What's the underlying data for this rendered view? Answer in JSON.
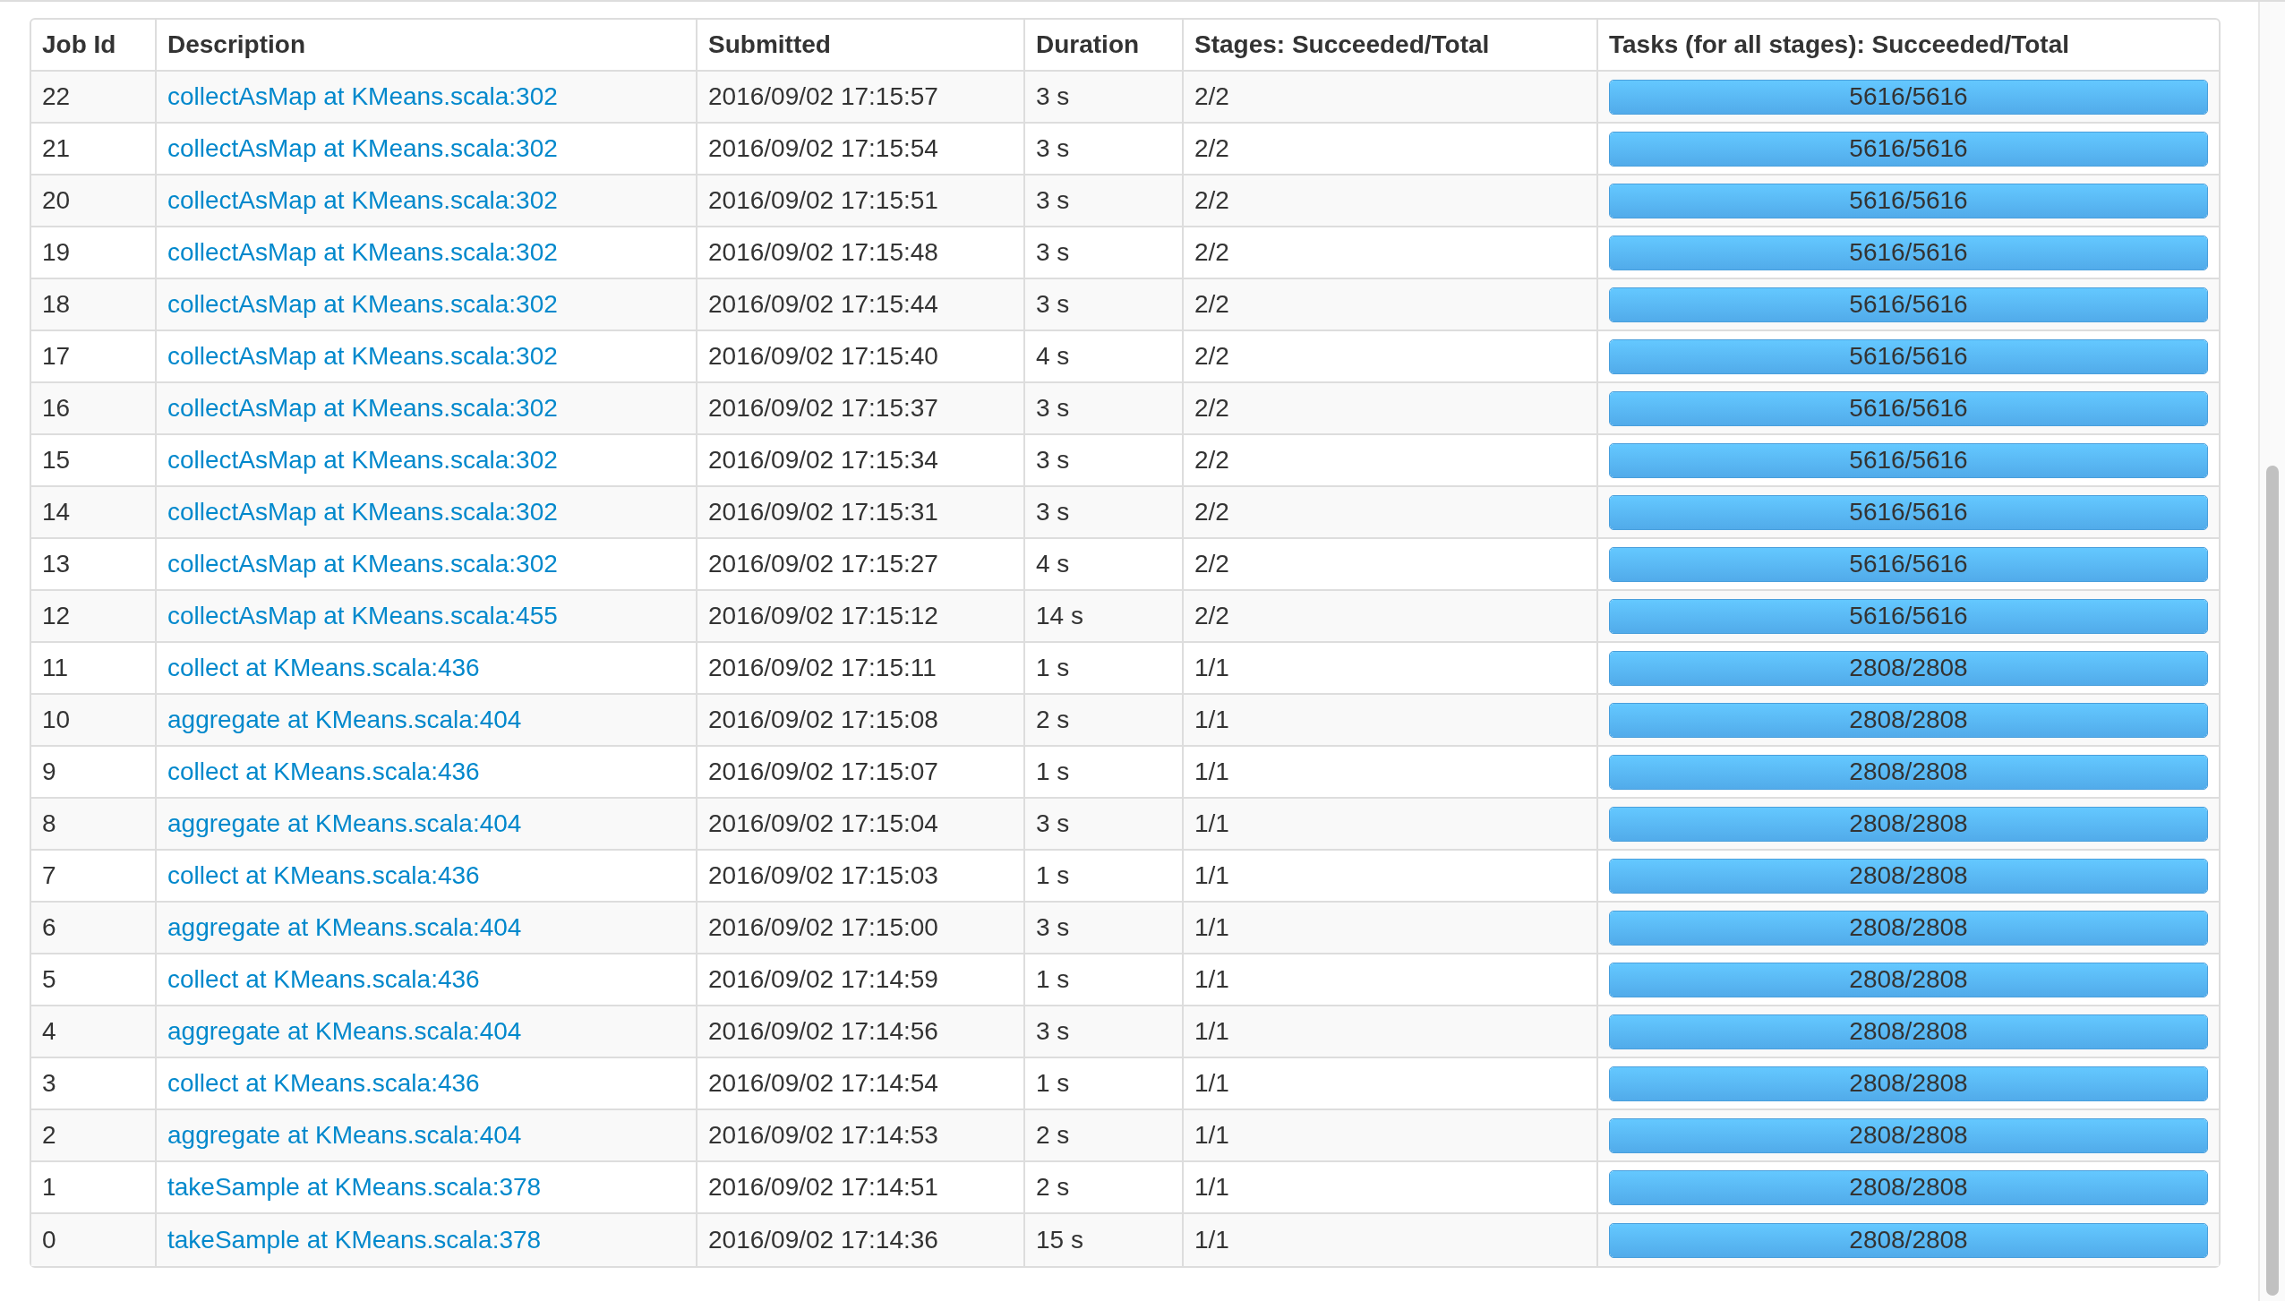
{
  "table": {
    "columns": [
      "Job Id",
      "Description",
      "Submitted",
      "Duration",
      "Stages: Succeeded/Total",
      "Tasks (for all stages): Succeeded/Total"
    ],
    "rows": [
      {
        "job_id": "22",
        "description": "collectAsMap at KMeans.scala:302",
        "submitted": "2016/09/02 17:15:57",
        "duration": "3 s",
        "stages": "2/2",
        "tasks": "5616/5616",
        "level": 1
      },
      {
        "job_id": "21",
        "description": "collectAsMap at KMeans.scala:302",
        "submitted": "2016/09/02 17:15:54",
        "duration": "3 s",
        "stages": "2/2",
        "tasks": "5616/5616",
        "level": 1
      },
      {
        "job_id": "20",
        "description": "collectAsMap at KMeans.scala:302",
        "submitted": "2016/09/02 17:15:51",
        "duration": "3 s",
        "stages": "2/2",
        "tasks": "5616/5616",
        "level": 1
      },
      {
        "job_id": "19",
        "description": "collectAsMap at KMeans.scala:302",
        "submitted": "2016/09/02 17:15:48",
        "duration": "3 s",
        "stages": "2/2",
        "tasks": "5616/5616",
        "level": 1
      },
      {
        "job_id": "18",
        "description": "collectAsMap at KMeans.scala:302",
        "submitted": "2016/09/02 17:15:44",
        "duration": "3 s",
        "stages": "2/2",
        "tasks": "5616/5616",
        "level": 1
      },
      {
        "job_id": "17",
        "description": "collectAsMap at KMeans.scala:302",
        "submitted": "2016/09/02 17:15:40",
        "duration": "4 s",
        "stages": "2/2",
        "tasks": "5616/5616",
        "level": 1
      },
      {
        "job_id": "16",
        "description": "collectAsMap at KMeans.scala:302",
        "submitted": "2016/09/02 17:15:37",
        "duration": "3 s",
        "stages": "2/2",
        "tasks": "5616/5616",
        "level": 1
      },
      {
        "job_id": "15",
        "description": "collectAsMap at KMeans.scala:302",
        "submitted": "2016/09/02 17:15:34",
        "duration": "3 s",
        "stages": "2/2",
        "tasks": "5616/5616",
        "level": 1
      },
      {
        "job_id": "14",
        "description": "collectAsMap at KMeans.scala:302",
        "submitted": "2016/09/02 17:15:31",
        "duration": "3 s",
        "stages": "2/2",
        "tasks": "5616/5616",
        "level": 1
      },
      {
        "job_id": "13",
        "description": "collectAsMap at KMeans.scala:302",
        "submitted": "2016/09/02 17:15:27",
        "duration": "4 s",
        "stages": "2/2",
        "tasks": "5616/5616",
        "level": 1
      },
      {
        "job_id": "12",
        "description": "collectAsMap at KMeans.scala:455",
        "submitted": "2016/09/02 17:15:12",
        "duration": "14 s",
        "stages": "2/2",
        "tasks": "5616/5616",
        "level": 1
      },
      {
        "job_id": "11",
        "description": "collect at KMeans.scala:436",
        "submitted": "2016/09/02 17:15:11",
        "duration": "1 s",
        "stages": "1/1",
        "tasks": "2808/2808",
        "level": 1
      },
      {
        "job_id": "10",
        "description": "aggregate at KMeans.scala:404",
        "submitted": "2016/09/02 17:15:08",
        "duration": "2 s",
        "stages": "1/1",
        "tasks": "2808/2808",
        "level": 1
      },
      {
        "job_id": "9",
        "description": "collect at KMeans.scala:436",
        "submitted": "2016/09/02 17:15:07",
        "duration": "1 s",
        "stages": "1/1",
        "tasks": "2808/2808",
        "level": 1
      },
      {
        "job_id": "8",
        "description": "aggregate at KMeans.scala:404",
        "submitted": "2016/09/02 17:15:04",
        "duration": "3 s",
        "stages": "1/1",
        "tasks": "2808/2808",
        "level": 1
      },
      {
        "job_id": "7",
        "description": "collect at KMeans.scala:436",
        "submitted": "2016/09/02 17:15:03",
        "duration": "1 s",
        "stages": "1/1",
        "tasks": "2808/2808",
        "level": 1
      },
      {
        "job_id": "6",
        "description": "aggregate at KMeans.scala:404",
        "submitted": "2016/09/02 17:15:00",
        "duration": "3 s",
        "stages": "1/1",
        "tasks": "2808/2808",
        "level": 1
      },
      {
        "job_id": "5",
        "description": "collect at KMeans.scala:436",
        "submitted": "2016/09/02 17:14:59",
        "duration": "1 s",
        "stages": "1/1",
        "tasks": "2808/2808",
        "level": 1
      },
      {
        "job_id": "4",
        "description": "aggregate at KMeans.scala:404",
        "submitted": "2016/09/02 17:14:56",
        "duration": "3 s",
        "stages": "1/1",
        "tasks": "2808/2808",
        "level": 1
      },
      {
        "job_id": "3",
        "description": "collect at KMeans.scala:436",
        "submitted": "2016/09/02 17:14:54",
        "duration": "1 s",
        "stages": "1/1",
        "tasks": "2808/2808",
        "level": 1
      },
      {
        "job_id": "2",
        "description": "aggregate at KMeans.scala:404",
        "submitted": "2016/09/02 17:14:53",
        "duration": "2 s",
        "stages": "1/1",
        "tasks": "2808/2808",
        "level": 1
      },
      {
        "job_id": "1",
        "description": "takeSample at KMeans.scala:378",
        "submitted": "2016/09/02 17:14:51",
        "duration": "2 s",
        "stages": "1/1",
        "tasks": "2808/2808",
        "level": 1
      },
      {
        "job_id": "0",
        "description": "takeSample at KMeans.scala:378",
        "submitted": "2016/09/02 17:14:36",
        "duration": "15 s",
        "stages": "1/1",
        "tasks": "2808/2808",
        "level": 1
      }
    ]
  }
}
